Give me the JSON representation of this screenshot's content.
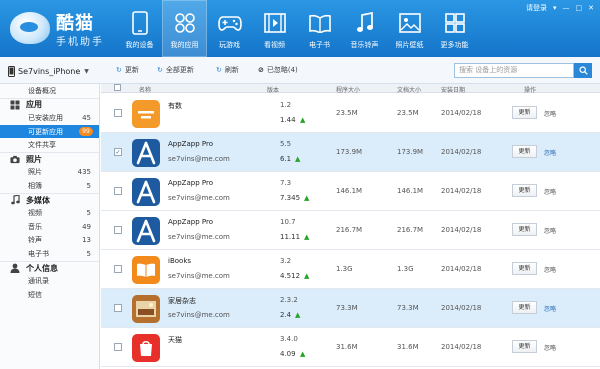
{
  "header": {
    "logo": {
      "name": "酷猫",
      "sub": "手机助手"
    },
    "login_label": "请登录",
    "nav": [
      {
        "label": "我的设备",
        "icon": "phone-icon",
        "active": false
      },
      {
        "label": "我的应用",
        "icon": "apps-icon",
        "active": true
      },
      {
        "label": "玩游戏",
        "icon": "gamepad-icon",
        "active": false
      },
      {
        "label": "看视频",
        "icon": "film-icon",
        "active": false
      },
      {
        "label": "电子书",
        "icon": "book-icon",
        "active": false
      },
      {
        "label": "音乐铃声",
        "icon": "music-note-icon",
        "active": false
      },
      {
        "label": "照片壁纸",
        "icon": "picture-icon",
        "active": false
      },
      {
        "label": "更多功能",
        "icon": "more-icon",
        "active": false
      }
    ]
  },
  "toolbar": {
    "device_name": "Se7vins_iPhone",
    "update_label": "更新",
    "update_all_label": "全部更新",
    "refresh_label": "刷新",
    "ignored_label": "已忽略(4)",
    "search_placeholder": "搜索 设备上的资源"
  },
  "sidebar": {
    "overview": "设备概况",
    "groups": [
      {
        "label": "应用",
        "icon": "apps-icon",
        "items": [
          {
            "label": "已安装应用",
            "count": "45"
          },
          {
            "label": "可更新应用",
            "badge": "99",
            "active": true
          },
          {
            "label": "文件共享",
            "count": ""
          }
        ]
      },
      {
        "label": "照片",
        "icon": "camera-icon",
        "items": [
          {
            "label": "照片",
            "count": "435"
          },
          {
            "label": "相簿",
            "count": "5"
          }
        ]
      },
      {
        "label": "多媒体",
        "icon": "music-note-icon",
        "items": [
          {
            "label": "视频",
            "count": "5"
          },
          {
            "label": "音乐",
            "count": "49"
          },
          {
            "label": "铃声",
            "count": "13"
          },
          {
            "label": "电子书",
            "count": "5"
          }
        ]
      },
      {
        "label": "个人信息",
        "icon": "person-icon",
        "items": [
          {
            "label": "通讯录",
            "count": ""
          },
          {
            "label": "短信",
            "count": ""
          }
        ]
      }
    ]
  },
  "table": {
    "columns": {
      "name": "名称",
      "version": "版本",
      "app_size": "程序大小",
      "doc_size": "文档大小",
      "install_date": "安装日期",
      "actions": "操作"
    },
    "update_label": "更新",
    "ignore_label": "忽略",
    "rows": [
      {
        "name": "有数",
        "publisher": "",
        "ver_old": "1.2",
        "ver_new": "1.44",
        "app_size": "23.5M",
        "doc_size": "23.5M",
        "date": "2014/02/18",
        "icon_color": "#f39a2a",
        "selected": false,
        "checked": false
      },
      {
        "name": "AppZapp Pro",
        "publisher": "se7vins@me.com",
        "ver_old": "5.5",
        "ver_new": "6.1",
        "app_size": "173.9M",
        "doc_size": "173.9M",
        "date": "2014/02/18",
        "icon_color": "#1e5aa0",
        "selected": true,
        "checked": true
      },
      {
        "name": "AppZapp Pro",
        "publisher": "se7vins@me.com",
        "ver_old": "7.3",
        "ver_new": "7.345",
        "app_size": "146.1M",
        "doc_size": "146.1M",
        "date": "2014/02/18",
        "icon_color": "#1e5aa0",
        "selected": false,
        "checked": false
      },
      {
        "name": "AppZapp Pro",
        "publisher": "se7vins@me.com",
        "ver_old": "10.7",
        "ver_new": "11.11",
        "app_size": "216.7M",
        "doc_size": "216.7M",
        "date": "2014/02/18",
        "icon_color": "#1e5aa0",
        "selected": false,
        "checked": false
      },
      {
        "name": "iBooks",
        "publisher": "se7vins@me.com",
        "ver_old": "3.2",
        "ver_new": "4.512",
        "app_size": "1.3G",
        "doc_size": "1.3G",
        "date": "2014/02/18",
        "icon_color": "#f28a1c",
        "selected": false,
        "checked": false
      },
      {
        "name": "家居杂志",
        "publisher": "se7vins@me.com",
        "ver_old": "2.3.2",
        "ver_new": "2.4",
        "app_size": "73.3M",
        "doc_size": "73.3M",
        "date": "2014/02/18",
        "icon_color": "#b6702e",
        "selected": true,
        "checked": false
      },
      {
        "name": "天猫",
        "publisher": "",
        "ver_old": "3.4.0",
        "ver_new": "4.09",
        "app_size": "31.6M",
        "doc_size": "31.6M",
        "date": "2014/02/18",
        "icon_color": "#e8302a",
        "selected": false,
        "checked": false
      }
    ]
  }
}
